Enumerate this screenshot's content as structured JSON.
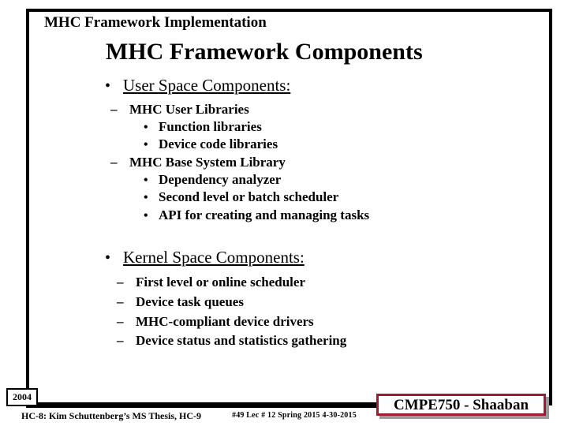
{
  "slide": {
    "kicker": "MHC Framework Implementation",
    "title": "MHC Framework Components",
    "sections": [
      {
        "heading": "User Space Components:",
        "marker": "•",
        "items": [
          {
            "marker": "–",
            "text": "MHC User Libraries"
          },
          {
            "marker": "•",
            "text": "Function libraries"
          },
          {
            "marker": "•",
            "text": "Device code libraries"
          },
          {
            "marker": "–",
            "text": "MHC Base System Library"
          },
          {
            "marker": "•",
            "text": "Dependency analyzer"
          },
          {
            "marker": "•",
            "text": "Second level or batch scheduler"
          },
          {
            "marker": "•",
            "text": "API for creating and managing tasks"
          }
        ]
      },
      {
        "heading": "Kernel Space Components:",
        "marker": "•",
        "items": [
          {
            "marker": "–",
            "text": "First level or online scheduler"
          },
          {
            "marker": "–",
            "text": "Device task queues"
          },
          {
            "marker": "–",
            "text": "MHC-compliant device drivers"
          },
          {
            "marker": "–",
            "text": "Device status and statistics gathering"
          }
        ]
      }
    ]
  },
  "footer": {
    "year_badge": "2004",
    "source_note": "HC-8: Kim Schuttenberg’s MS Thesis, HC-9",
    "meta": "#49  Lec # 12  Spring 2015  4-30-2015",
    "course_credit": "CMPE750 - Shaaban",
    "accent_color": "#9e1b32",
    "shadow_color": "#9a9a9a"
  }
}
